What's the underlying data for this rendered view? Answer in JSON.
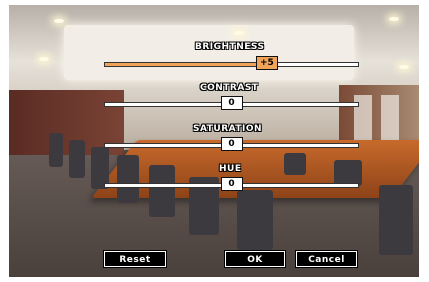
{
  "adjustments": {
    "brightness": {
      "label": "BRIGHTNESS",
      "value": "+5",
      "level": 0.64
    },
    "contrast": {
      "label": "CONTRAST",
      "value": "0",
      "level": 0.5
    },
    "saturation": {
      "label": "SATURATION",
      "value": "0",
      "level": 0.5
    },
    "hue": {
      "label": "HUE",
      "value": "0",
      "level": 0.5
    }
  },
  "buttons": {
    "reset": "Reset",
    "ok": "OK",
    "cancel": "Cancel"
  },
  "colors": {
    "highlight": "#f0a45a",
    "osd_text": "#ffffff",
    "button_bg": "#000000"
  }
}
